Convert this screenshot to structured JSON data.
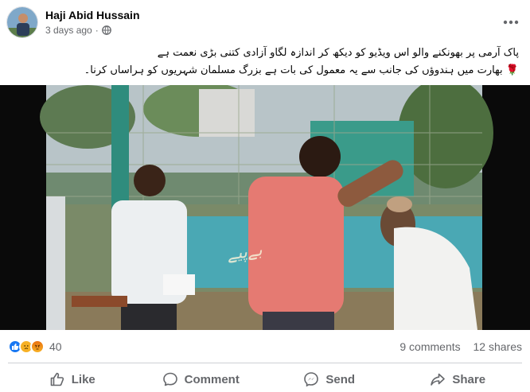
{
  "post": {
    "author": "Haji Abid Hussain",
    "time": "3 days ago",
    "separator": "·",
    "privacy_icon": "globe-icon",
    "more_icon": "more-horizontal-icon"
  },
  "caption": {
    "line1": "پاک آرمی پر بھونکنے والو اس ویڈیو کو دیکھ کر اندازہ لگاو آزادی کتنی بڑی نعمت ہے",
    "line2": "بھارت میں ہندوؤں کی جانب سے یہ معمول کی بات ہے بزرگ مسلمان شہریوں کو ہراساں کرنا۔",
    "emoji": "🌹"
  },
  "video": {
    "watermark": "بےپیے"
  },
  "stats": {
    "reaction_icons": [
      "like-icon",
      "sad-icon",
      "angry-icon"
    ],
    "reaction_count": "40",
    "comments": "9 comments",
    "shares": "12 shares"
  },
  "actions": {
    "like": "Like",
    "comment": "Comment",
    "send": "Send",
    "share": "Share"
  },
  "colors": {
    "brand_blue": "#1877f2",
    "secondary_text": "#65676b",
    "divider": "#ced0d4"
  }
}
